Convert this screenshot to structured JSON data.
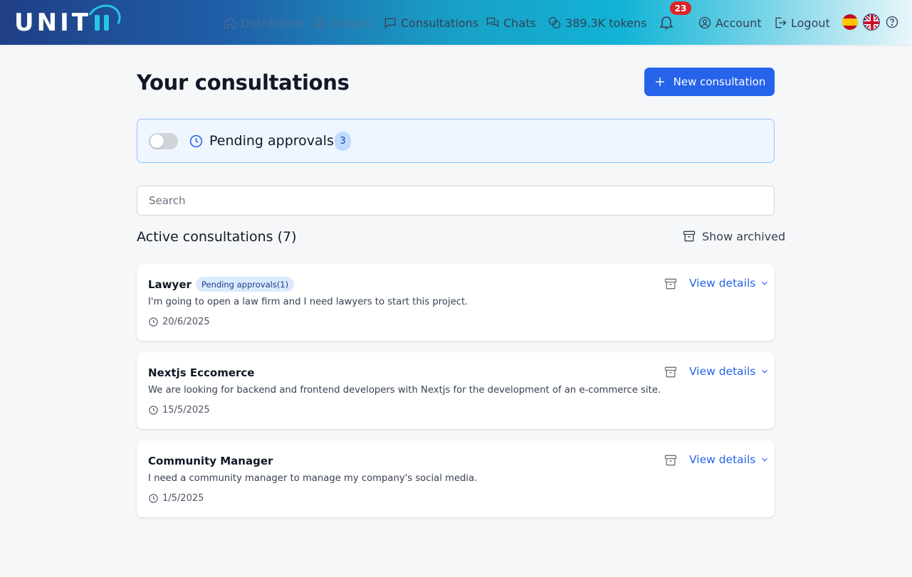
{
  "brand": {
    "logo_text": "UNIT",
    "logo_alt": "UNITii"
  },
  "nav": {
    "dashboard": "Dashboard",
    "groups": "Groups",
    "consultations": "Consultations",
    "chats": "Chats",
    "tokens": "389.3K tokens",
    "notifications_count": "23",
    "account": "Account",
    "logout": "Logout"
  },
  "languages": [
    "es",
    "en"
  ],
  "page": {
    "title": "Your consultations",
    "new_button": "New consultation"
  },
  "pending": {
    "label": "Pending approvals",
    "count": "3",
    "toggle_on": false
  },
  "search": {
    "placeholder": "Search",
    "value": ""
  },
  "section": {
    "title": "Active consultations (7)",
    "show_archived": "Show archived"
  },
  "consultations": [
    {
      "title": "Lawyer",
      "tag": "Pending approvals(1)",
      "description": "I'm going to open a law firm and I need lawyers to start this project.",
      "date": "20/6/2025",
      "view": "View details"
    },
    {
      "title": "Nextjs Eccomerce",
      "tag": "",
      "description": "We are looking for backend and frontend developers with Nextjs for the development of an e-commerce site.",
      "date": "15/5/2025",
      "view": "View details"
    },
    {
      "title": "Community Manager",
      "tag": "",
      "description": "I need a community manager to manage my company's social media.",
      "date": "1/5/2025",
      "view": "View details"
    }
  ],
  "colors": {
    "primary": "#2563eb",
    "badge_red": "#dc2626",
    "pending_bg": "#eff6ff",
    "pending_border": "#93c5fd"
  }
}
